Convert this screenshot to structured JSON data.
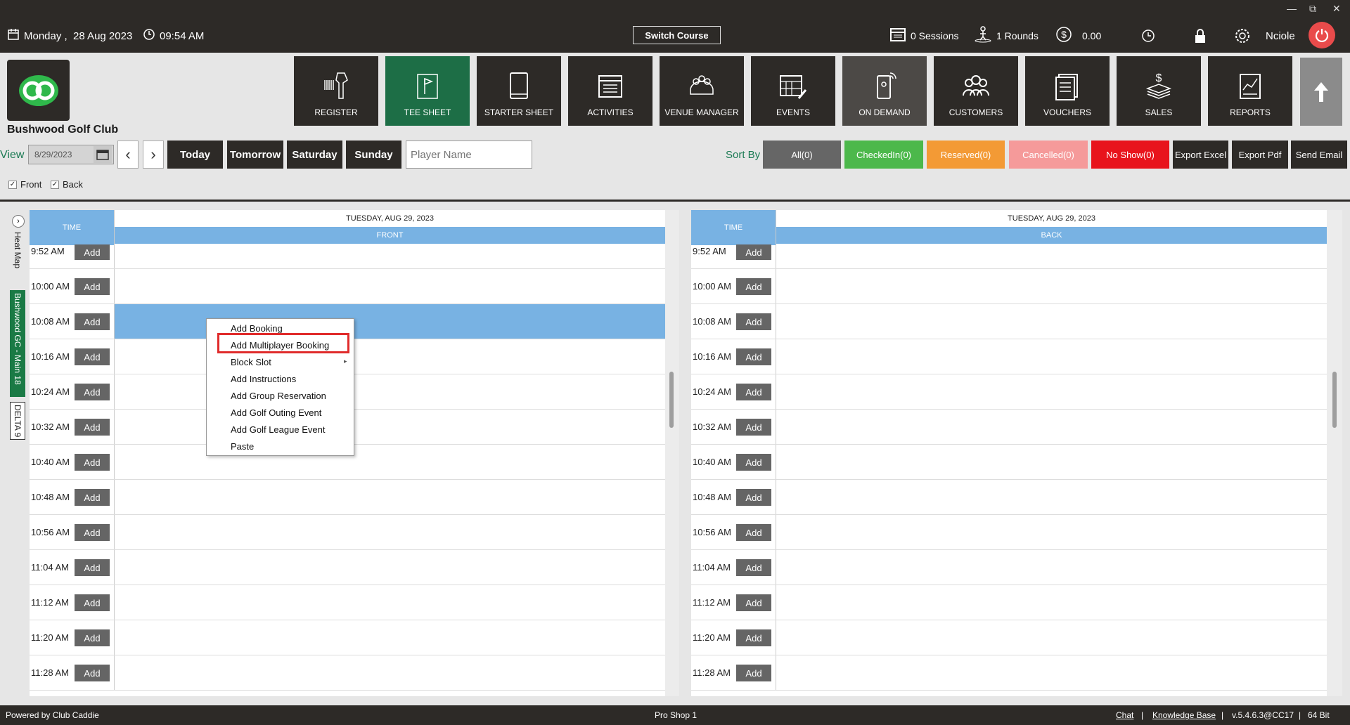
{
  "topbar": {
    "date": "Monday ,  28 Aug 2023",
    "time": "09:54 AM",
    "switch_course": "Switch Course",
    "sessions": "0 Sessions",
    "rounds": "1 Rounds",
    "balance": "0.00",
    "user": "Nciole"
  },
  "club": {
    "name": "Bushwood Golf Club"
  },
  "nav": [
    {
      "label": "REGISTER",
      "icon": "barcode-scanner-icon"
    },
    {
      "label": "TEE SHEET",
      "icon": "flag-sheet-icon"
    },
    {
      "label": "STARTER SHEET",
      "icon": "tablet-icon"
    },
    {
      "label": "ACTIVITIES",
      "icon": "calendar-list-icon"
    },
    {
      "label": "VENUE MANAGER",
      "icon": "venue-people-icon"
    },
    {
      "label": "EVENTS",
      "icon": "calendar-edit-icon"
    },
    {
      "label": "ON DEMAND",
      "icon": "phone-signal-icon"
    },
    {
      "label": "CUSTOMERS",
      "icon": "customers-icon"
    },
    {
      "label": "VOUCHERS",
      "icon": "voucher-icon"
    },
    {
      "label": "SALES",
      "icon": "sales-money-icon"
    },
    {
      "label": "REPORTS",
      "icon": "report-chart-icon"
    }
  ],
  "filters": {
    "view_label": "View",
    "date": "8/29/2023",
    "days": [
      "Today",
      "Tomorrow",
      "Saturday",
      "Sunday"
    ],
    "player_placeholder": "Player Name",
    "sort_by": "Sort By",
    "sorts": [
      {
        "label": "All(0)",
        "color": "#666666"
      },
      {
        "label": "CheckedIn(0)",
        "color": "#4cb84b"
      },
      {
        "label": "Reserved(0)",
        "color": "#f39a35"
      },
      {
        "label": "Cancelled(0)",
        "color": "#f59a9a"
      },
      {
        "label": "No Show(0)",
        "color": "#e8141c"
      }
    ],
    "actions": [
      "Export Excel",
      "Export Pdf",
      "Send Email"
    ],
    "front": "Front",
    "back": "Back"
  },
  "side": {
    "heat_map": "Heat Map",
    "course_tab": "Bushwood GC - Main 18",
    "delta_tab": "DELTA 9"
  },
  "grid": {
    "time_header": "TIME",
    "date_header": "TUESDAY, AUG 29, 2023",
    "front_label": "FRONT",
    "back_label": "BACK",
    "add_label": "Add",
    "times": [
      "9:52 AM",
      "10:00 AM",
      "10:08 AM",
      "10:16 AM",
      "10:24 AM",
      "10:32 AM",
      "10:40 AM",
      "10:48 AM",
      "10:56 AM",
      "11:04 AM",
      "11:12 AM",
      "11:20 AM",
      "11:28 AM"
    ]
  },
  "context_menu": {
    "items": [
      "Add Booking",
      "Add Multiplayer Booking",
      "Block Slot",
      "Add Instructions",
      "Add Group Reservation",
      "Add Golf Outing Event",
      "Add Golf League Event",
      "Paste"
    ]
  },
  "footer": {
    "powered": "Powered by Club Caddie",
    "station": "Pro Shop 1",
    "chat": "Chat",
    "kb": "Knowledge Base",
    "version": "v.5.4.6.3@CC17",
    "bits": "64 Bit",
    "sep": "|"
  }
}
